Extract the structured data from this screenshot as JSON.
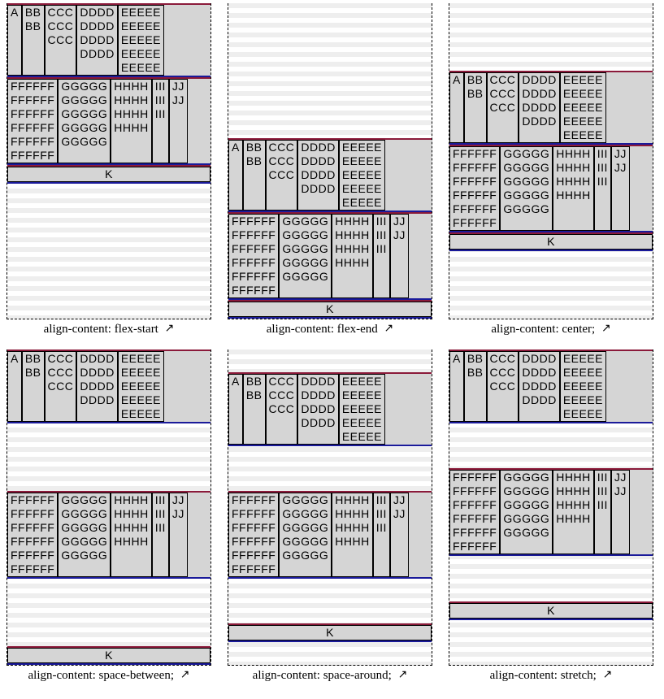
{
  "examples": [
    {
      "value": "flex-start",
      "caption": "align-content: flex-start"
    },
    {
      "value": "flex-end",
      "caption": "align-content: flex-end"
    },
    {
      "value": "center",
      "caption": "align-content: center;"
    },
    {
      "value": "space-between",
      "caption": "align-content: space-between;"
    },
    {
      "value": "space-around",
      "caption": "align-content: space-around;"
    },
    {
      "value": "stretch",
      "caption": "align-content: stretch;"
    }
  ],
  "row1": [
    {
      "text": "A"
    },
    {
      "text": "BB\nBB"
    },
    {
      "text": "CCC\nCCC\nCCC"
    },
    {
      "text": "DDDD\nDDDD\nDDDD\nDDDD"
    },
    {
      "text": "EEEEE\nEEEEE\nEEEEE\nEEEEE\nEEEEE"
    }
  ],
  "row2": [
    {
      "text": "FFFFFF\nFFFFFF\nFFFFFF\nFFFFFF\nFFFFFF\nFFFFFF"
    },
    {
      "text": "GGGGG\nGGGGG\nGGGGG\nGGGGG\nGGGGG"
    },
    {
      "text": "HHHH\nHHHH\nHHHH\nHHHH"
    },
    {
      "text": "III\nIII\nIII"
    },
    {
      "text": "JJ\nJJ"
    }
  ],
  "row3": [
    {
      "text": "K"
    }
  ],
  "arrow": "↗"
}
